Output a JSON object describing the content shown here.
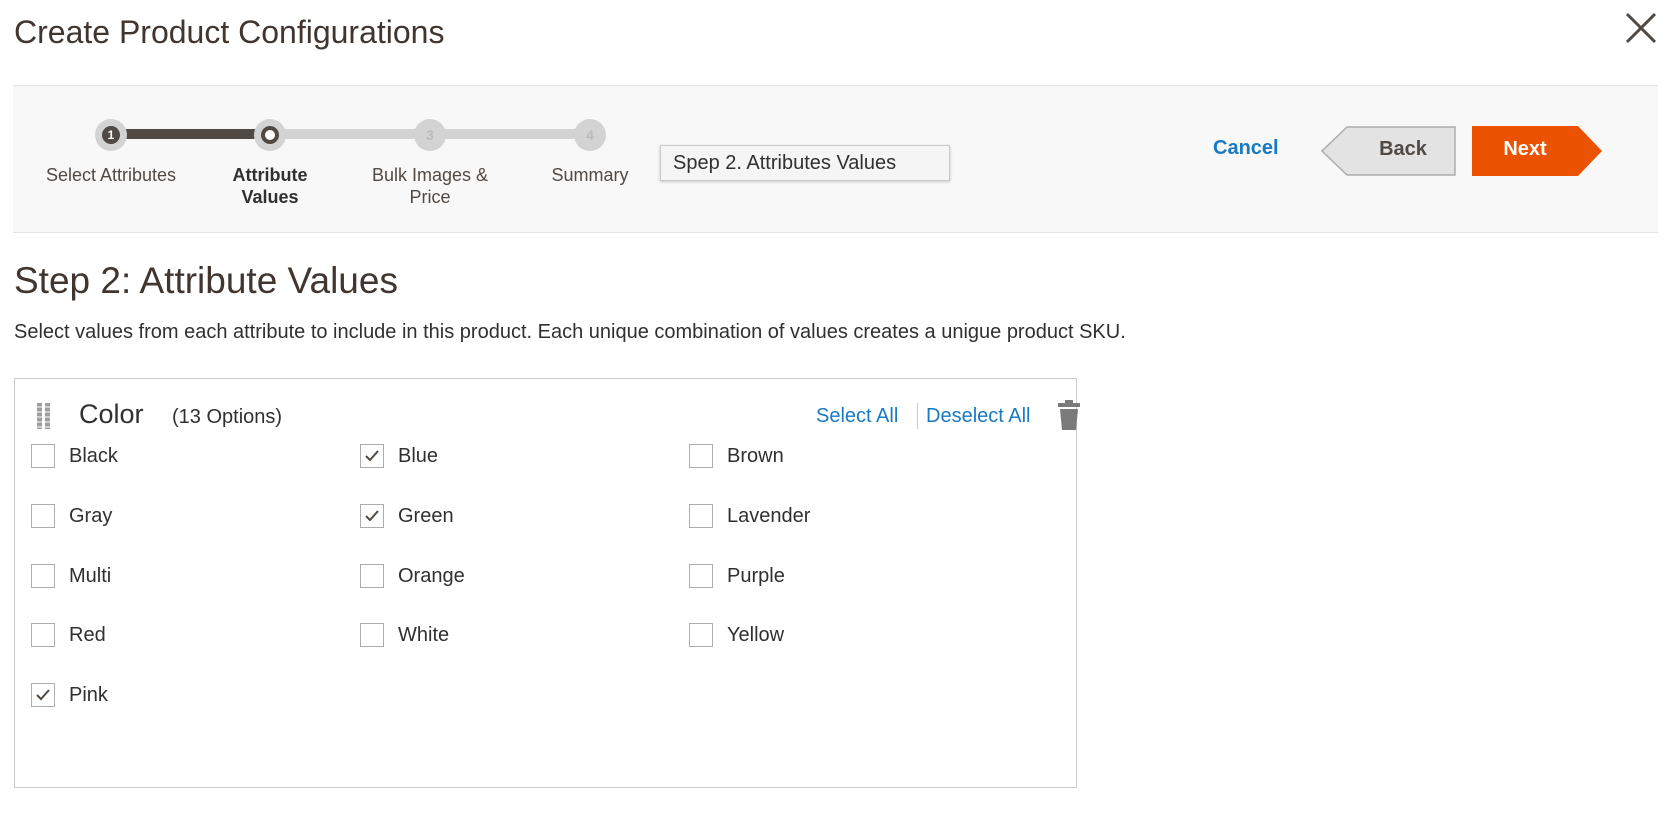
{
  "modal": {
    "title": "Create Product Configurations"
  },
  "wizard": {
    "steps": [
      {
        "number": "1",
        "label": "Select Attributes",
        "state": "done"
      },
      {
        "number": "",
        "label": "Attribute Values",
        "state": "active"
      },
      {
        "number": "3",
        "label": "Bulk Images & Price",
        "state": "pending"
      },
      {
        "number": "4",
        "label": "Summary",
        "state": "pending"
      }
    ],
    "tooltip": "Spep 2. Attributes Values",
    "cancel_label": "Cancel",
    "back_label": "Back",
    "next_label": "Next",
    "accent_color": "#eb5202"
  },
  "step": {
    "heading": "Step 2: Attribute Values",
    "description": "Select values from each attribute to include in this product. Each unique combination of values creates a unigue product SKU."
  },
  "attribute": {
    "name": "Color",
    "count": "(13 Options)",
    "select_all": "Select All",
    "deselect_all": "Deselect All",
    "options": [
      {
        "label": "Black",
        "checked": false
      },
      {
        "label": "Blue",
        "checked": true
      },
      {
        "label": "Brown",
        "checked": false
      },
      {
        "label": "Gray",
        "checked": false
      },
      {
        "label": "Green",
        "checked": true
      },
      {
        "label": "Lavender",
        "checked": false
      },
      {
        "label": "Multi",
        "checked": false
      },
      {
        "label": "Orange",
        "checked": false
      },
      {
        "label": "Purple",
        "checked": false
      },
      {
        "label": "Red",
        "checked": false
      },
      {
        "label": "White",
        "checked": false
      },
      {
        "label": "Yellow",
        "checked": false
      },
      {
        "label": "Pink",
        "checked": true
      }
    ]
  }
}
